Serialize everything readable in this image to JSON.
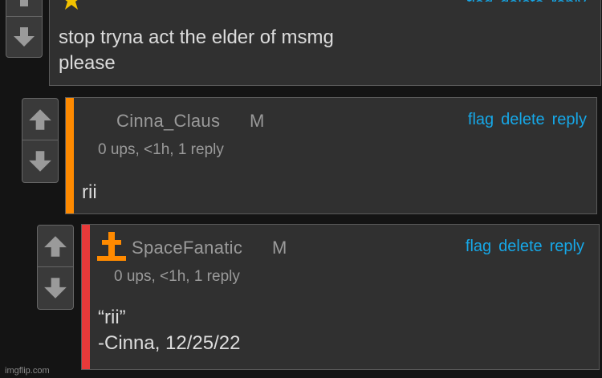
{
  "comments": [
    {
      "username": "",
      "rank": "",
      "meta": "",
      "body_lines": [
        "stop tryna act the elder of msmg",
        "please"
      ]
    },
    {
      "username": "Cinna_Claus",
      "rank": "M",
      "meta": "0 ups, <1h, 1 reply",
      "flag_label": "flag",
      "delete_label": "delete",
      "reply_label": "reply",
      "accent_color": "#ff8a00",
      "body_lines": [
        "rii"
      ]
    },
    {
      "username": "SpaceFanatic",
      "rank": "M",
      "meta": "0 ups, <1h, 1 reply",
      "flag_label": "flag",
      "delete_label": "delete",
      "reply_label": "reply",
      "accent_color": "#e83a3a",
      "icon": "orange-cross-badge-icon",
      "body_lines": [
        "“rii”",
        "-Cinna, 12/25/22"
      ]
    }
  ],
  "watermark": "imgflip.com",
  "icons": {
    "upvote": "up-arrow-icon",
    "downvote": "down-arrow-icon",
    "top_badge": "star-badge-icon"
  }
}
